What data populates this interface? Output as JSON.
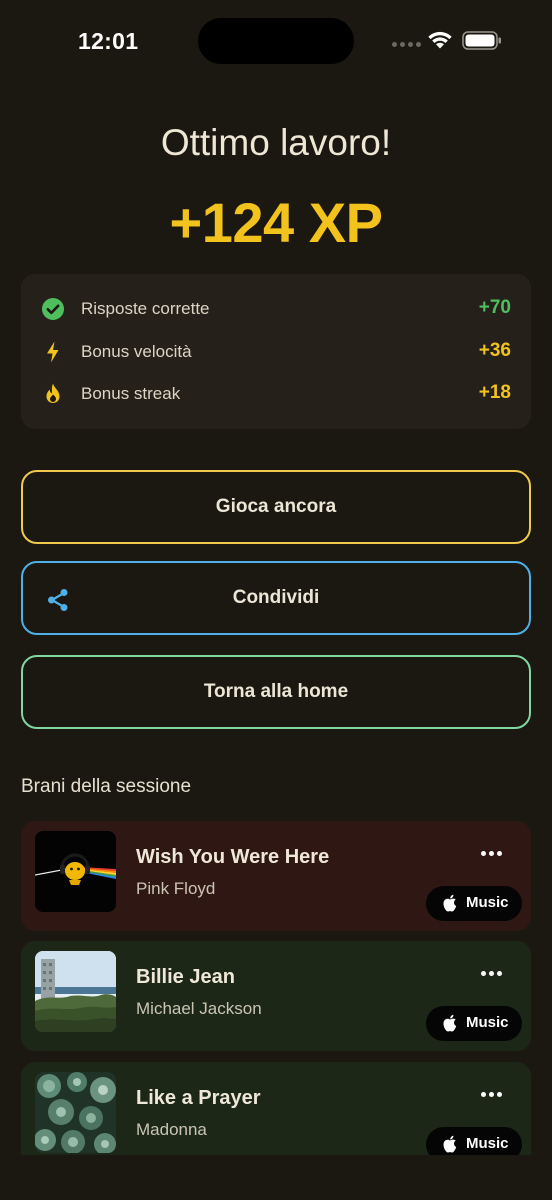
{
  "status_bar": {
    "time": "12:01"
  },
  "header": {
    "title": "Ottimo lavoro!",
    "xp": "+124 XP"
  },
  "breakdown": [
    {
      "label": "Risposte corrette",
      "value": "+70",
      "icon": "check-circle-icon",
      "color": "#4fbf5e"
    },
    {
      "label": "Bonus velocità",
      "value": "+36",
      "icon": "lightning-icon",
      "color": "#f2c21d"
    },
    {
      "label": "Bonus streak",
      "value": "+18",
      "icon": "flame-icon",
      "color": "#f2c21d"
    }
  ],
  "actions": {
    "play_again": "Gioca ancora",
    "share": "Condividi",
    "home": "Torna alla home"
  },
  "songs_section": {
    "title": "Brani della sessione"
  },
  "songs": [
    {
      "title": "Wish You Were Here",
      "artist": "Pink Floyd",
      "service": "Music",
      "card_color": "#2f1813"
    },
    {
      "title": "Billie Jean",
      "artist": "Michael Jackson",
      "service": "Music",
      "card_color": "#1c2718"
    },
    {
      "title": "Like a Prayer",
      "artist": "Madonna",
      "service": "Music",
      "card_color": "#1c2718"
    }
  ],
  "colors": {
    "background": "#1b1811",
    "accent_xp": "#f2c21d",
    "play_border": "#f0c94c",
    "share_border": "#4fb0e8",
    "home_border": "#7fd8a0"
  }
}
